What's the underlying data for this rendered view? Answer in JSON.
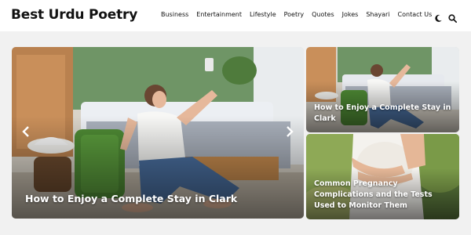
{
  "site": {
    "title": "Best Urdu Poetry"
  },
  "nav": {
    "items": [
      "Business",
      "Entertainment",
      "Lifestyle",
      "Poetry",
      "Quotes",
      "Jokes",
      "Shayari",
      "Contact Us"
    ],
    "icons": [
      "moon-icon",
      "search-icon"
    ]
  },
  "featured": {
    "main": {
      "title": "How to Enjoy a Complete Stay in Clark"
    },
    "side": [
      {
        "title": "How to Enjoy a Complete Stay in Clark"
      },
      {
        "title": "Common Pregnancy Complications and the Tests Used to Monitor Them"
      }
    ]
  },
  "slider": {
    "prev_icon": "chevron-left-icon",
    "next_icon": "chevron-right-icon"
  }
}
